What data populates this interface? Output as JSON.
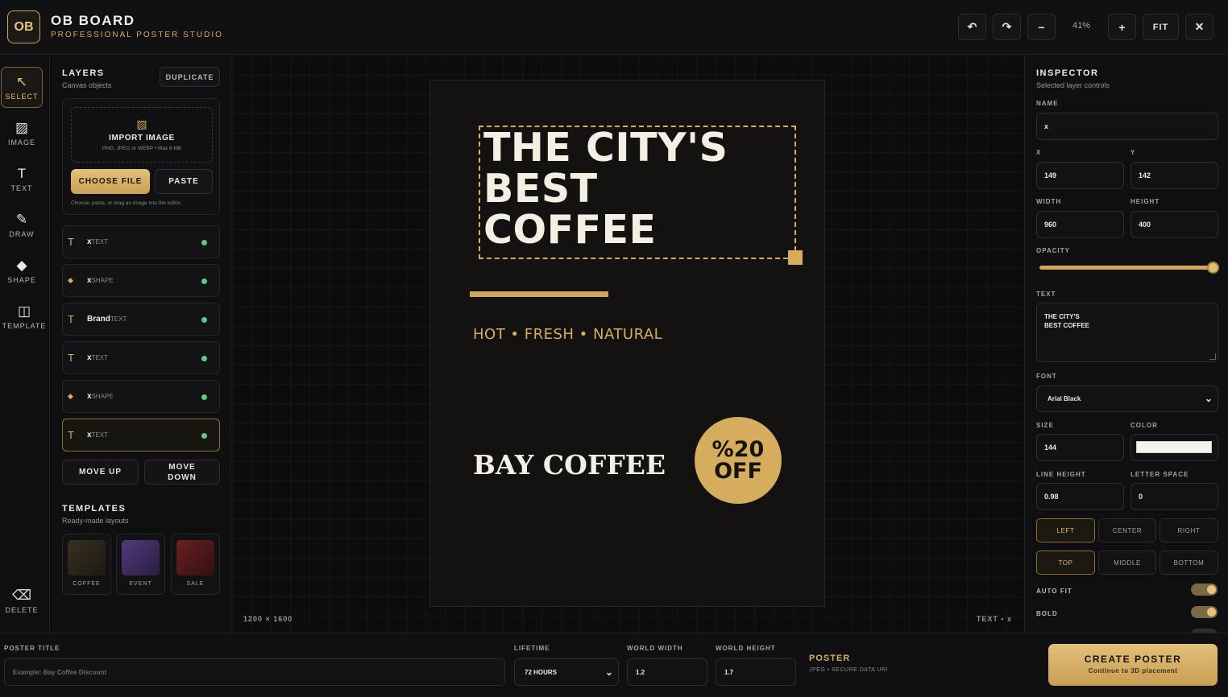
{
  "header": {
    "logo": "OB",
    "title": "OB BOARD",
    "subtitle": "PROFESSIONAL POSTER STUDIO",
    "zoom": "41%",
    "fit_label": "FIT"
  },
  "tools": [
    {
      "label": "SELECT",
      "icon": "cursor-icon",
      "active": true
    },
    {
      "label": "IMAGE",
      "icon": "image-icon"
    },
    {
      "label": "TEXT",
      "icon": "text-icon"
    },
    {
      "label": "DRAW",
      "icon": "pencil-icon"
    },
    {
      "label": "SHAPE",
      "icon": "diamond-icon"
    },
    {
      "label": "TEMPLATE",
      "icon": "template-icon"
    },
    {
      "label": "DELETE",
      "icon": "delete-icon"
    }
  ],
  "layers_panel": {
    "title": "LAYERS",
    "subtitle": "Canvas objects",
    "duplicate_label": "DUPLICATE",
    "import": {
      "title": "IMPORT IMAGE",
      "sub": "PNG, JPEG or WEBP • Max 8 MB",
      "choose_label": "CHOOSE FILE",
      "paste_label": "PASTE",
      "hint": "Choose, paste, or drag an image into the editor."
    },
    "layers": [
      {
        "name": "x",
        "type": "TEXT",
        "icon": "text-icon"
      },
      {
        "name": "x",
        "type": "SHAPE",
        "icon": "diamond-icon"
      },
      {
        "name": "Brand",
        "type": "TEXT",
        "icon": "text-icon"
      },
      {
        "name": "x",
        "type": "TEXT",
        "icon": "text-icon"
      },
      {
        "name": "x",
        "type": "SHAPE",
        "icon": "diamond-icon"
      },
      {
        "name": "x",
        "type": "TEXT",
        "icon": "text-icon",
        "selected": true
      }
    ],
    "move_up_label": "MOVE UP",
    "move_down_label": "MOVE DOWN",
    "templates_title": "TEMPLATES",
    "templates_sub": "Ready-made layouts",
    "templates": [
      {
        "name": "COFFEE",
        "color": "#2b2418"
      },
      {
        "name": "EVENT",
        "color": "#3d2a5e"
      },
      {
        "name": "SALE",
        "color": "#4a1a1c"
      }
    ]
  },
  "poster": {
    "headline_line1": "THE CITY'S",
    "headline_line2": "BEST",
    "headline_line3": "COFFEE",
    "tagline": "HOT • FRESH • NATURAL",
    "brand": "BAY COFFEE",
    "badge_line1": "%20",
    "badge_line2": "OFF",
    "accent": "#d6ad5d",
    "background": "#141210"
  },
  "canvas": {
    "dimensions": "1200 × 1600",
    "selection_info": "TEXT • x"
  },
  "inspector": {
    "title": "INSPECTOR",
    "subtitle": "Selected layer controls",
    "name_label": "NAME",
    "name_value": "x",
    "x_label": "X",
    "x_value": "149",
    "y_label": "Y",
    "y_value": "142",
    "width_label": "WIDTH",
    "width_value": "960",
    "height_label": "HEIGHT",
    "height_value": "400",
    "opacity_label": "OPACITY",
    "opacity_value": 1.0,
    "text_label": "TEXT",
    "text_line1": "THE CITY'S",
    "text_line2": "BEST COFFEE",
    "font_label": "FONT",
    "font_value": "Arial Black",
    "size_label": "SIZE",
    "size_value": "144",
    "color_label": "COLOR",
    "color_value": "#f6f3ec",
    "line_height_label": "LINE HEIGHT",
    "line_height_value": "0.98",
    "letter_space_label": "LETTER SPACE",
    "letter_space_value": "0",
    "align_options": [
      "LEFT",
      "CENTER",
      "RIGHT"
    ],
    "align_selected": "LEFT",
    "valign_options": [
      "TOP",
      "MIDDLE",
      "BOTTOM"
    ],
    "valign_selected": "TOP",
    "auto_fit_label": "AUTO FIT",
    "bold_label": "BOLD"
  },
  "bottom_bar": {
    "poster_title_label": "POSTER TITLE",
    "poster_title_placeholder": "Example: Bay Coffee Discount",
    "lifetime_label": "LIFETIME",
    "lifetime_value": "72 HOURS",
    "world_width_label": "WORLD WIDTH",
    "world_width_value": "1.2",
    "world_height_label": "WORLD HEIGHT",
    "world_height_value": "1.7",
    "poster_label": "POSTER",
    "poster_sub": "JPEG • SECURE DATA URI",
    "create_label": "CREATE POSTER",
    "create_sub": "Continue to 3D placement"
  }
}
